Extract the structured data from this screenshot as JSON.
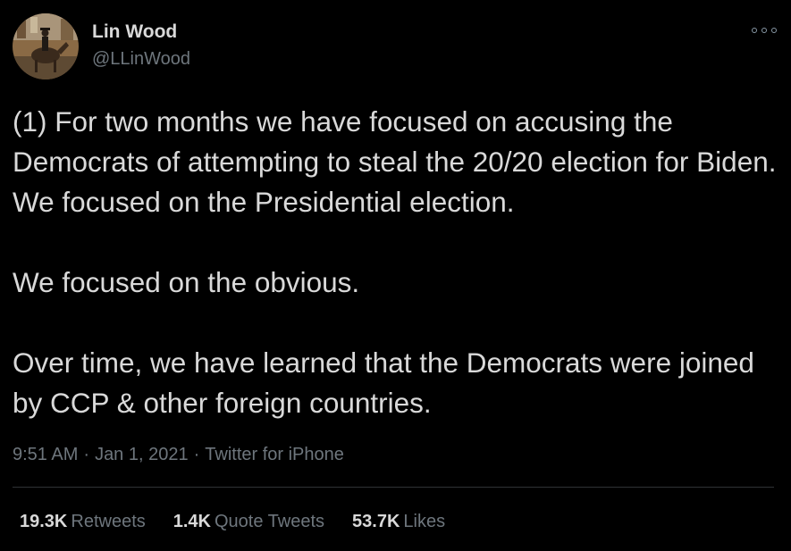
{
  "author": {
    "name": "Lin Wood",
    "handle": "@LLinWood",
    "avatar_icon": "avatar-rider-on-horse"
  },
  "menu_icon": "more-options-icon",
  "tweet": {
    "paragraphs": [
      "(1) For two months we have focused on accusing the Democrats of attempting to steal the 20/20 election for Biden. We focused on the Presidential election.",
      "We focused on the obvious.",
      "Over time, we have learned that the Democrats were joined by CCP & other foreign countries."
    ],
    "time": "9:51 AM",
    "date": "Jan 1, 2021",
    "source": "Twitter for iPhone",
    "separator": "·"
  },
  "stats": {
    "retweets": {
      "count": "19.3K",
      "label": "Retweets"
    },
    "quote_tweets": {
      "count": "1.4K",
      "label": "Quote Tweets"
    },
    "likes": {
      "count": "53.7K",
      "label": "Likes"
    }
  },
  "colors": {
    "background": "#000000",
    "text": "#d9d9d9",
    "secondary": "#6e767d",
    "divider": "#2f3336"
  }
}
